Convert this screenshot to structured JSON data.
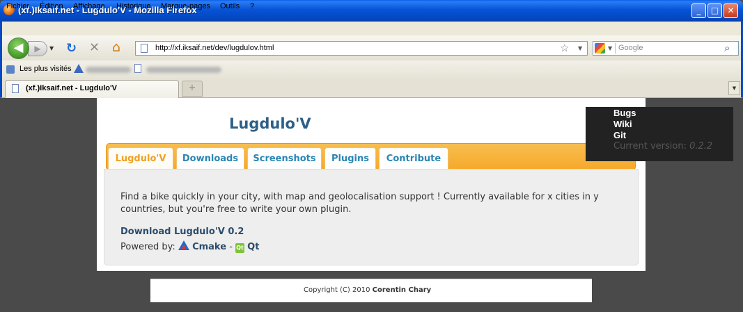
{
  "window": {
    "title": "(xf.)Iksaif.net - Lugdulo'V - Mozilla Firefox",
    "buttons": {
      "minimize": "_",
      "maximize": "□",
      "close": "✕"
    }
  },
  "menu": [
    "Fichier",
    "Édition",
    "Affichage",
    "Historique",
    "Marque-pages",
    "Outils",
    "?"
  ],
  "navbar": {
    "url": "http://xf.iksaif.net/dev/lugdulov.html",
    "search_placeholder": "Google"
  },
  "bookmarks": {
    "most_visited": "Les plus visités"
  },
  "browser_tab": {
    "title": "(xf.)Iksaif.net - Lugdulo'V"
  },
  "site": {
    "title": "Lugdulo'V",
    "tabs": [
      {
        "label": "Lugdulo'V",
        "active": true
      },
      {
        "label": "Downloads",
        "active": false
      },
      {
        "label": "Screenshots",
        "active": false
      },
      {
        "label": "Plugins",
        "active": false
      },
      {
        "label": "Contribute",
        "active": false
      }
    ],
    "description": "Find a bike quickly in your city, with map and geolocalisation support ! Currently available for x cities in y countries, but you're free to write your own plugin.",
    "download_link": "Download Lugdulo'V 0.2",
    "powered_by_label": "Powered by:",
    "powered_cmake": "Cmake",
    "powered_sep": "-",
    "powered_qt": "Qt",
    "side_links": [
      "Bugs",
      "Wiki",
      "Git"
    ],
    "version_label": "Current version:",
    "version_value": "0.2.2",
    "footer_prefix": "Copyright (C) 2010",
    "footer_author": "Corentin Chary"
  },
  "colors": {
    "titlebar_blue": "#0653d6",
    "site_title": "#2c6089",
    "tab_orange": "#f6a92a",
    "tab_link": "#2a86b4",
    "active_tab_text": "#f0a020",
    "side_panel": "#222222",
    "page_background": "#4a4a4a"
  },
  "icons": [
    "firefox-logo-icon",
    "back-arrow-icon",
    "forward-arrow-icon",
    "reload-icon",
    "stop-icon",
    "home-icon",
    "page-icon",
    "star-icon",
    "google-icon",
    "magnifier-icon",
    "cmake-icon",
    "qt-icon"
  ]
}
